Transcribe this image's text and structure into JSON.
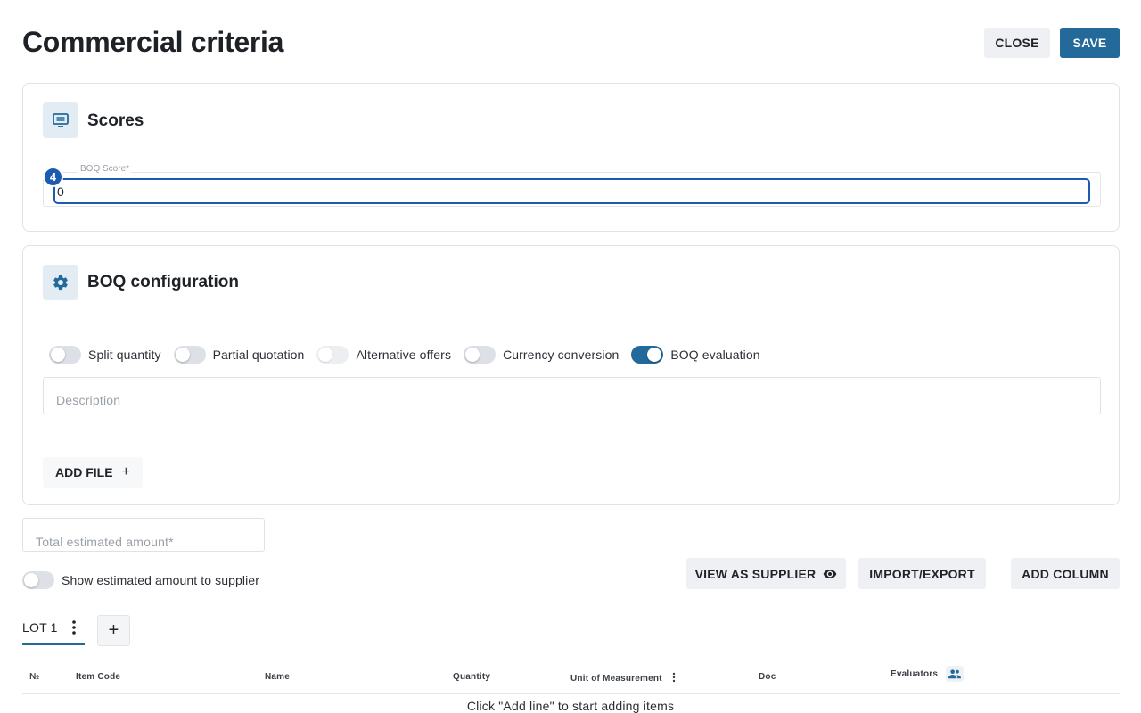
{
  "header": {
    "title": "Commercial criteria",
    "close_label": "CLOSE",
    "save_label": "SAVE"
  },
  "scores": {
    "title": "Scores",
    "boq_score_label": "BOQ Score*",
    "boq_score_value": "0",
    "step_badge": "4",
    "icon": "scoreboard-icon"
  },
  "boq_config": {
    "title": "BOQ configuration",
    "icon": "gear-icon",
    "toggles": [
      {
        "label": "Split quantity",
        "state": "off"
      },
      {
        "label": "Partial quotation",
        "state": "off"
      },
      {
        "label": "Alternative offers",
        "state": "disabled"
      },
      {
        "label": "Currency conversion",
        "state": "off"
      },
      {
        "label": "BOQ evaluation",
        "state": "on"
      }
    ],
    "description_placeholder": "Description",
    "add_file_label": "ADD FILE",
    "add_file_icon": "+"
  },
  "estimate": {
    "total_placeholder": "Total estimated amount*",
    "show_to_supplier_label": "Show estimated amount to supplier",
    "show_to_supplier_state": "off"
  },
  "actions": {
    "view_as_supplier": "VIEW AS SUPPLIER",
    "import_export": "IMPORT/EXPORT",
    "add_column": "ADD COLUMN"
  },
  "lots": {
    "tabs": [
      {
        "label": "LOT 1"
      }
    ],
    "add_icon": "+"
  },
  "table": {
    "columns": [
      "№",
      "Item Code",
      "Name",
      "Quantity",
      "Unit of Measurement",
      "Doc",
      "Evaluators"
    ],
    "empty_message": "Click \"Add line\" to start adding items"
  },
  "colors": {
    "primary": "#23699a",
    "focus": "#1c5bb0",
    "light_button": "#eef0f4"
  }
}
